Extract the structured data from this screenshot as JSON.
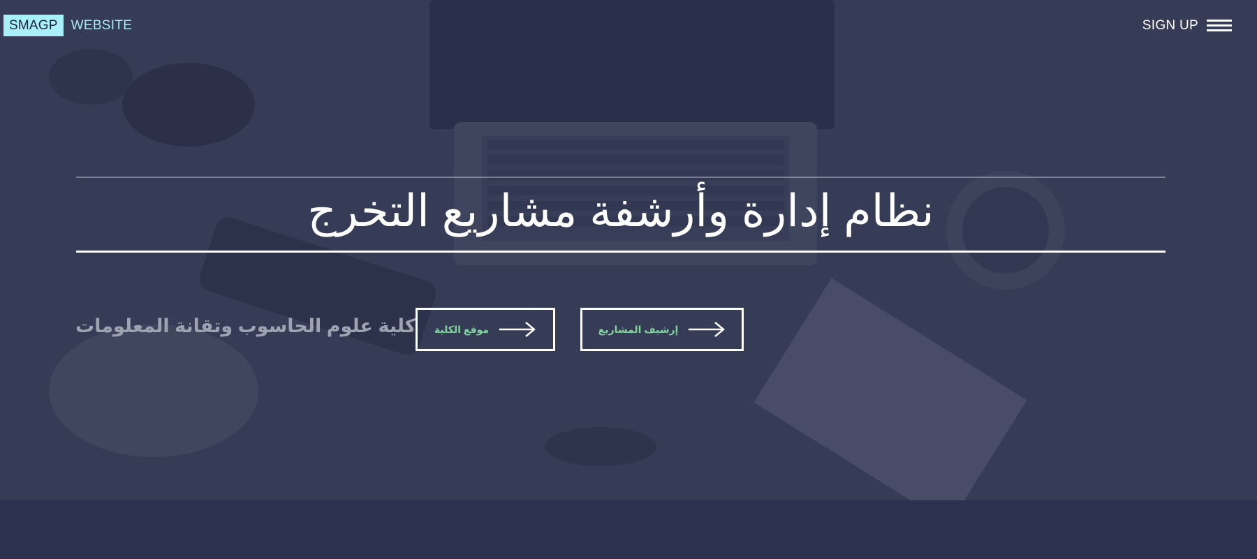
{
  "header": {
    "brand_box": "SMAGP",
    "brand_text": "WEBSITE",
    "signup_label": "SIGN UP",
    "menu_icon": "hamburger-menu-icon"
  },
  "hero": {
    "title": "نظام إدارة وأرشفة مشاريع التخرج",
    "college_name": "كلية علوم الحاسوب وتقانة المعلومات",
    "buttons": [
      {
        "label": "موقع الكلية",
        "icon": "arrow-right-icon"
      },
      {
        "label": "إرشيف المشاريع",
        "icon": "arrow-right-icon"
      }
    ]
  },
  "colors": {
    "hero_overlay": "#3a3e55",
    "footer_band": "#2c3150",
    "brand_box_bg": "#a9f0fb",
    "brand_text": "#a9e9f5",
    "button_label": "#7fd39c",
    "college_text": "#9ea3b2"
  }
}
